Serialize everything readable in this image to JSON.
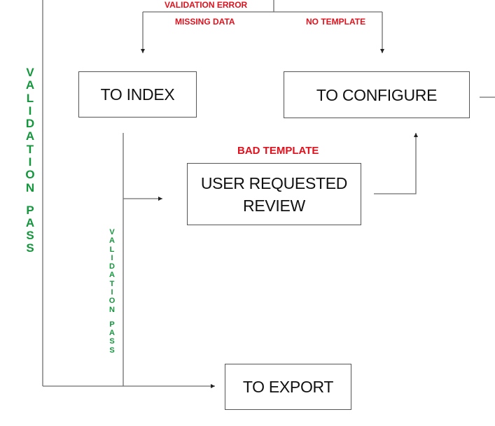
{
  "diagram": {
    "nodes": {
      "to_index": "TO INDEX",
      "to_configure": "TO CONFIGURE",
      "user_requested_review": "USER REQUESTED\nREVIEW",
      "user_requested_review_line1": "USER REQUESTED",
      "user_requested_review_line2": "REVIEW",
      "to_export": "TO EXPORT"
    },
    "edge_labels": {
      "validation_error": "VALIDATION ERROR",
      "missing_data": "MISSING DATA",
      "no_template": "NO TEMPLATE",
      "bad_template": "BAD TEMPLATE",
      "validation_pass_outer": "VALIDATION PASS",
      "validation_pass_inner": "VALIDATION PASS"
    },
    "edges": [
      {
        "from": "validation",
        "to": "to_index",
        "label": "MISSING DATA"
      },
      {
        "from": "validation",
        "to": "to_configure",
        "label": "NO TEMPLATE"
      },
      {
        "from": "to_index",
        "to": "user_requested_review",
        "label": ""
      },
      {
        "from": "user_requested_review",
        "to": "to_configure",
        "label": "BAD TEMPLATE"
      },
      {
        "from": "to_index",
        "to": "to_export",
        "label": "VALIDATION PASS"
      },
      {
        "from": "validation",
        "to": "to_export",
        "label": "VALIDATION PASS"
      }
    ],
    "colors": {
      "error_label": "#e0101c",
      "pass_label": "#13963c",
      "line": "#6e6e6e",
      "box_border": "#555555"
    }
  }
}
